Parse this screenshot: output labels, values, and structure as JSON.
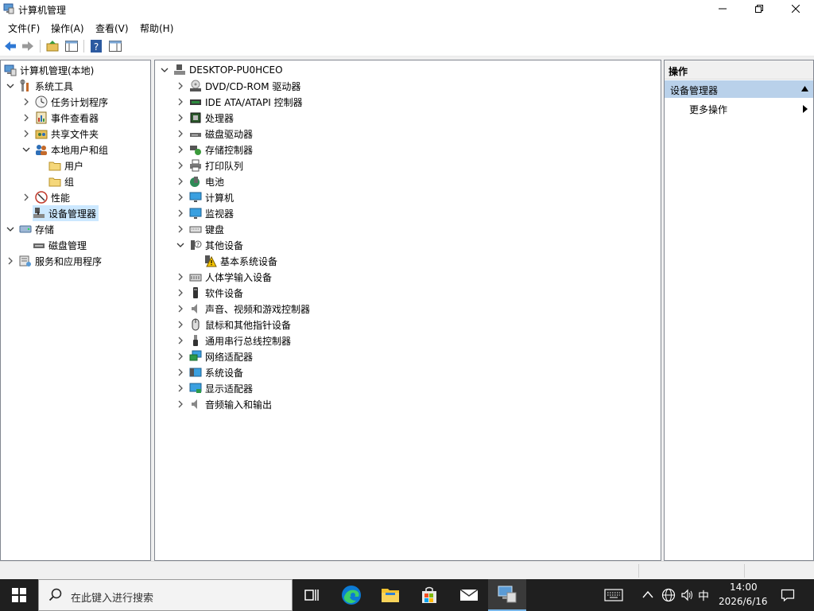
{
  "window": {
    "title": "计算机管理"
  },
  "menu": {
    "items": [
      "文件(F)",
      "操作(A)",
      "查看(V)",
      "帮助(H)"
    ]
  },
  "tree": {
    "root": "计算机管理(本地)",
    "system_tools": "系统工具",
    "task_scheduler": "任务计划程序",
    "event_viewer": "事件查看器",
    "shared_folders": "共享文件夹",
    "local_users": "本地用户和组",
    "users": "用户",
    "groups": "组",
    "performance": "性能",
    "device_manager": "设备管理器",
    "storage": "存储",
    "disk_management": "磁盘管理",
    "services": "服务和应用程序"
  },
  "devices": {
    "computer_name": "DESKTOP-PU0HCEO",
    "categories": [
      "DVD/CD-ROM 驱动器",
      "IDE ATA/ATAPI 控制器",
      "处理器",
      "磁盘驱动器",
      "存储控制器",
      "打印队列",
      "电池",
      "计算机",
      "监视器",
      "键盘",
      "其他设备",
      "人体学输入设备",
      "软件设备",
      "声音、视频和游戏控制器",
      "鼠标和其他指针设备",
      "通用串行总线控制器",
      "网络适配器",
      "系统设备",
      "显示适配器",
      "音频输入和输出"
    ],
    "other_child": "基本系统设备"
  },
  "actions": {
    "header": "操作",
    "section": "设备管理器",
    "more": "更多操作"
  },
  "taskbar": {
    "search_placeholder": "在此键入进行搜索",
    "time": "14:00",
    "date": "2026/6/16",
    "ime": "中"
  },
  "colors": {
    "selection": "#cce8ff",
    "action_section": "#b9d1ea",
    "taskbar": "#1f1f1f"
  }
}
